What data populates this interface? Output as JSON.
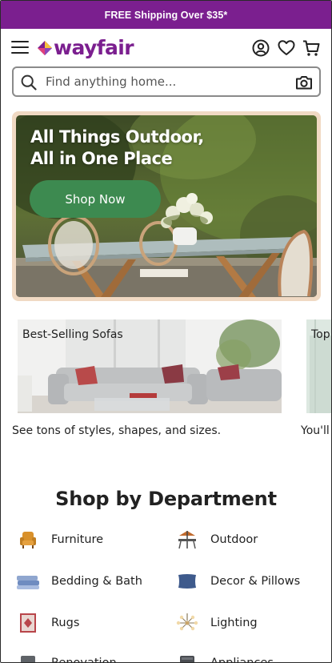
{
  "promo": {
    "text": "FREE Shipping Over $35*",
    "bg_color": "#7b1f8f"
  },
  "header": {
    "logo_text": "wayfair",
    "brand_color": "#7b1f8f",
    "icons": [
      "menu-icon",
      "account-icon",
      "heart-icon",
      "cart-icon"
    ]
  },
  "search": {
    "placeholder": "Find anything home...",
    "value": ""
  },
  "hero": {
    "title": "All Things Outdoor,\nAll in One Place",
    "button_label": "Shop Now",
    "button_color": "#3d8a50"
  },
  "carousel": {
    "cards": [
      {
        "title": "Best-Selling Sofas",
        "description": "See tons of styles, shapes, and sizes."
      },
      {
        "title": "Top",
        "description": "You'll"
      }
    ]
  },
  "departments": {
    "title": "Shop by Department",
    "items": [
      {
        "label": "Furniture",
        "icon": "armchair-icon"
      },
      {
        "label": "Outdoor",
        "icon": "patio-table-icon"
      },
      {
        "label": "Bedding & Bath",
        "icon": "towels-icon"
      },
      {
        "label": "Decor & Pillows",
        "icon": "pillow-icon"
      },
      {
        "label": "Rugs",
        "icon": "rug-icon"
      },
      {
        "label": "Lighting",
        "icon": "chandelier-icon"
      },
      {
        "label": "Renovation",
        "icon": "renovation-icon"
      },
      {
        "label": "Appliances",
        "icon": "appliance-icon"
      }
    ]
  }
}
